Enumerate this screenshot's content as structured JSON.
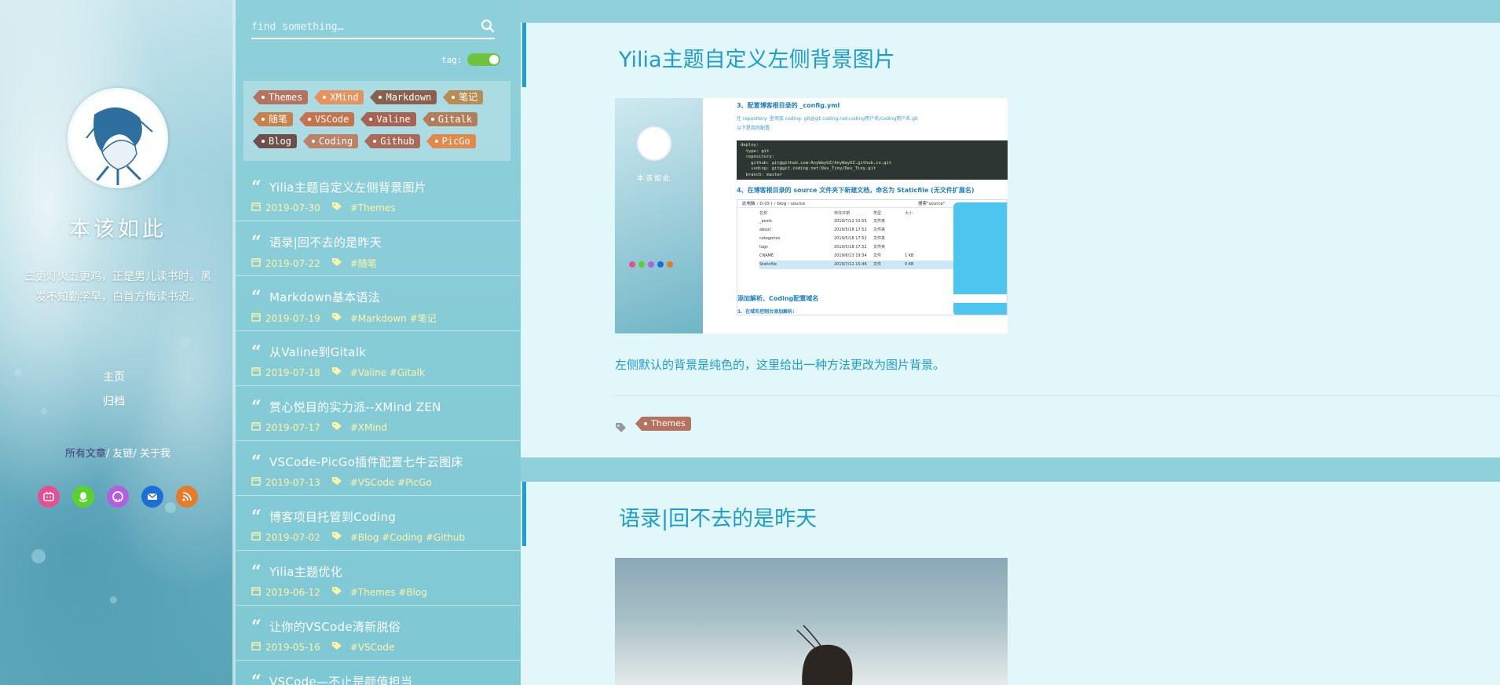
{
  "sidebar": {
    "site_title": "本该如此",
    "motto": "三更灯火五更鸡，正是男儿读书时。黑发不知勤学早，白首方悔读书迟。",
    "nav": [
      "主页",
      "归档"
    ],
    "links": {
      "all": "所有文章",
      "friends": "友链",
      "about": "关于我",
      "sep": "/"
    },
    "social": [
      {
        "icon": "bilibili-icon",
        "color": "#e84f92"
      },
      {
        "icon": "qq-icon",
        "color": "#5ad22c"
      },
      {
        "icon": "github-icon",
        "color": "#b65ee0"
      },
      {
        "icon": "mail-icon",
        "color": "#1b6fd6"
      },
      {
        "icon": "rss-icon",
        "color": "#e87a2a"
      }
    ]
  },
  "search": {
    "placeholder": "find something…"
  },
  "tag_toggle": {
    "label": "tag:"
  },
  "tags": [
    {
      "name": "Themes",
      "color": "#b5725f"
    },
    {
      "name": "XMind",
      "color": "#e7925c"
    },
    {
      "name": "Markdown",
      "color": "#8a5f4d"
    },
    {
      "name": "笔记",
      "color": "#b88d55"
    },
    {
      "name": "随笔",
      "color": "#c9804a"
    },
    {
      "name": "VSCode",
      "color": "#c4734d"
    },
    {
      "name": "Valine",
      "color": "#a86252"
    },
    {
      "name": "Gitalk",
      "color": "#b47d5a"
    },
    {
      "name": "Blog",
      "color": "#6f4f4a"
    },
    {
      "name": "Coding",
      "color": "#bd8168"
    },
    {
      "name": "Github",
      "color": "#ab6957"
    },
    {
      "name": "PicGo",
      "color": "#e4874a"
    }
  ],
  "posts": [
    {
      "title": "Yilia主题自定义左侧背景图片",
      "date": "2019-07-30",
      "tags": "#Themes"
    },
    {
      "title": "语录|回不去的是昨天",
      "date": "2019-07-22",
      "tags": "#随笔"
    },
    {
      "title": "Markdown基本语法",
      "date": "2019-07-19",
      "tags": "#Markdown #笔记"
    },
    {
      "title": "从Valine到Gitalk",
      "date": "2019-07-18",
      "tags": "#Valine #Gitalk"
    },
    {
      "title": "赏心悦目的实力派--XMind ZEN",
      "date": "2019-07-17",
      "tags": "#XMind"
    },
    {
      "title": "VSCode-PicGo插件配置七牛云图床",
      "date": "2019-07-13",
      "tags": "#VSCode #PicGo"
    },
    {
      "title": "博客项目托管到Coding",
      "date": "2019-07-02",
      "tags": "#Blog #Coding #Github"
    },
    {
      "title": "Yilia主题优化",
      "date": "2019-06-12",
      "tags": "#Themes #Blog"
    },
    {
      "title": "让你的VSCode清新脱俗",
      "date": "2019-05-16",
      "tags": "#VSCode"
    },
    {
      "title": "VSCode—不止是颜值担当",
      "date": "",
      "tags": ""
    }
  ],
  "articles": [
    {
      "title": "Yilia主题自定义左侧背景图片",
      "desc": "左侧默认的背景是纯色的，这里给出一种方法更改为图片背景。",
      "tag": "Themes",
      "tag_color": "#b5725f",
      "screenshot": {
        "step3": "3、配置博客根目录的 _config.yml",
        "step3_note": "在 repository: 里添加 coding: git@git.coding.net:coding用户名/coding用户名.git",
        "step3_sub": "以下是我的配置:",
        "code": [
          "deploy:",
          "  type: git",
          "  repository:",
          "    github: git@github.com:AnyWayUZ/AnyWayUZ.github.io.git",
          "    coding: git@git.coding.net:Dev_Tiny/Dev_Tiny.git",
          "  branch: master"
        ],
        "step4": "4、在博客根目录的 source 文件夹下新建文档，命名为 Staticfile (无文件扩展名)",
        "explorer_path": "此电脑 › D:(D:) › blog › source",
        "explorer_search": "搜索\"source\"",
        "explorer_headers": [
          "名称",
          "修改日期",
          "类型",
          "大小"
        ],
        "explorer_rows": [
          {
            "name": "_posts",
            "date": "2019/7/12 10:55",
            "type": "文件夹",
            "size": ""
          },
          {
            "name": "about",
            "date": "2019/5/18 17:52",
            "type": "文件夹",
            "size": ""
          },
          {
            "name": "categories",
            "date": "2019/5/18 17:52",
            "type": "文件夹",
            "size": ""
          },
          {
            "name": "tags",
            "date": "2019/5/18 17:52",
            "type": "文件夹",
            "size": ""
          },
          {
            "name": "CNAME",
            "date": "2019/6/13 19:34",
            "type": "文件",
            "size": "1 KB"
          },
          {
            "name": "Staticfile",
            "date": "2019/7/12 15:46",
            "type": "文件",
            "size": "0 KB"
          }
        ],
        "section": "添加解析、Coding配置域名",
        "step_last": "1、在域名控制台添加解析:",
        "mini_title": "本该如此"
      }
    },
    {
      "title": "语录|回不去的是昨天"
    }
  ]
}
